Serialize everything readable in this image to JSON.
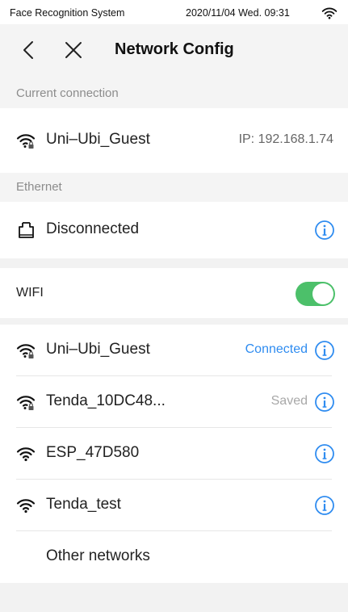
{
  "statusbar": {
    "app_name": "Face Recognition System",
    "datetime": "2020/11/04  Wed.  09:31",
    "icon": "wifi-icon"
  },
  "navbar": {
    "title": "Network Config",
    "back_icon": "chevron-left-icon",
    "close_icon": "close-icon"
  },
  "current_connection": {
    "label": "Current connection",
    "network": "Uni–Ubi_Guest",
    "ip": "IP:  192.168.1.74"
  },
  "ethernet": {
    "label": "Ethernet",
    "status": "Disconnected"
  },
  "wifi": {
    "label": "WIFI",
    "enabled": true,
    "networks": [
      {
        "name": "Uni–Ubi_Guest",
        "status": "Connected",
        "secured": true
      },
      {
        "name": "Tenda_10DC48...",
        "status": "Saved",
        "secured": true
      },
      {
        "name": "ESP_47D580",
        "status": "",
        "secured": false
      },
      {
        "name": "Tenda_test",
        "status": "",
        "secured": false
      }
    ],
    "other": "Other networks"
  },
  "colors": {
    "accent": "#2f8cf0",
    "toggle_on": "#4cc06a",
    "muted": "#8c8c8c",
    "saved": "#a8a8a8"
  }
}
